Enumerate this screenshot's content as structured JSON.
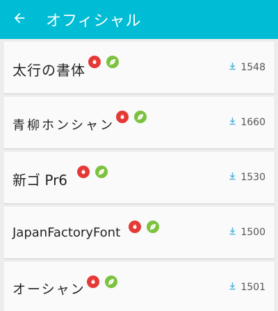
{
  "appbar": {
    "title": "オフィシャル",
    "back_icon": "arrow-left-icon",
    "color": "#00bcd4"
  },
  "fonts": [
    {
      "name": "太行の書体",
      "downloads": "1548",
      "hot": true,
      "free": true
    },
    {
      "name": "青柳ホンシャン",
      "downloads": "1660",
      "hot": true,
      "free": true
    },
    {
      "name": "新ゴ Pr6",
      "downloads": "1530",
      "hot": true,
      "free": true
    },
    {
      "name": "JapanFactoryFont",
      "downloads": "1500",
      "hot": true,
      "free": true
    },
    {
      "name": "オーシャン",
      "downloads": "1501",
      "hot": true,
      "free": true
    }
  ],
  "colors": {
    "hot_badge": "#e53935",
    "free_badge": "#7cc23f",
    "download_icon": "#4fb3d9"
  }
}
